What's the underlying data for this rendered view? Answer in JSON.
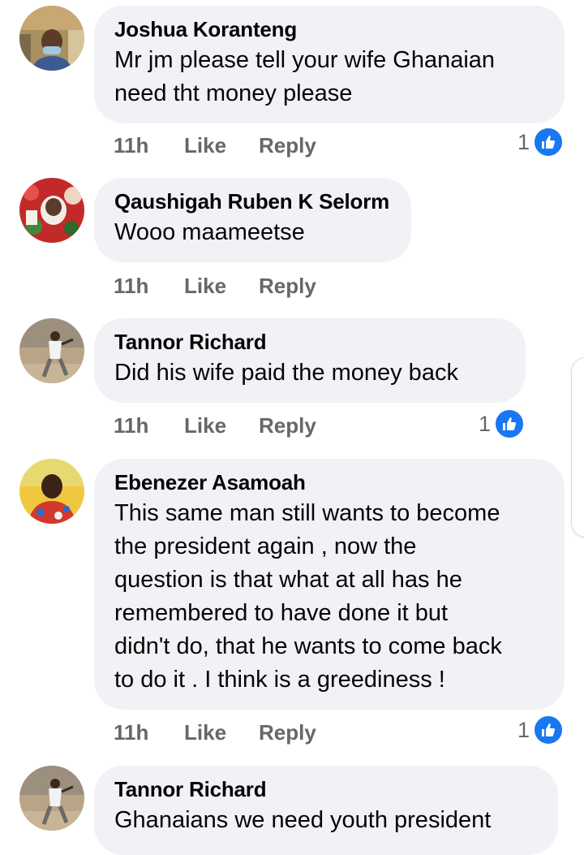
{
  "colors": {
    "bubble_bg": "#f0f2f5",
    "meta_text": "#65676b",
    "like_blue": "#1877f2"
  },
  "comments": [
    {
      "author": "Joshua Koranteng",
      "text": "Mr jm please tell your wife Ghanaian\nneed tht money please",
      "time": "11h",
      "like_label": "Like",
      "reply_label": "Reply",
      "reaction_count": "1",
      "reaction_icon": "thumbs-up-icon"
    },
    {
      "author": "Qaushigah Ruben K Selorm",
      "text": "Wooo maameetse",
      "time": "11h",
      "like_label": "Like",
      "reply_label": "Reply"
    },
    {
      "author": "Tannor Richard",
      "text": "Did his wife paid the money back",
      "time": "11h",
      "like_label": "Like",
      "reply_label": "Reply",
      "reaction_count": "1",
      "reaction_icon": "thumbs-up-icon"
    },
    {
      "author": "Ebenezer Asamoah",
      "text": "This same man still wants to become\nthe president again , now the\nquestion is that what at all has he\nremembered to have done it but\ndidn't do, that he wants to come back\nto do it . I think is a greediness !",
      "time": "11h",
      "like_label": "Like",
      "reply_label": "Reply",
      "reaction_count": "1",
      "reaction_icon": "thumbs-up-icon"
    },
    {
      "author": "Tannor Richard",
      "text": "Ghanaians we need youth president"
    }
  ]
}
